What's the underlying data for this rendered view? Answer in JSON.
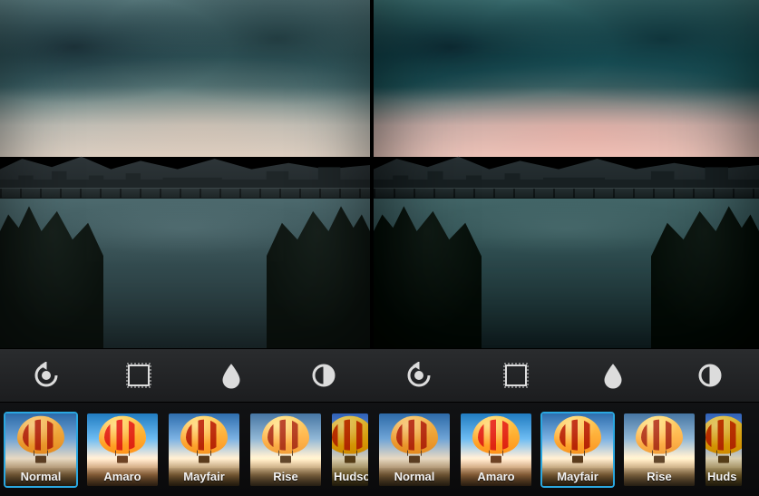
{
  "panes": {
    "left": {
      "applied_filter": "Normal"
    },
    "right": {
      "applied_filter": "Mayfair"
    }
  },
  "toolbar": {
    "items": [
      {
        "name": "rotate",
        "icon": "rotate-icon"
      },
      {
        "name": "border",
        "icon": "frame-icon"
      },
      {
        "name": "tiltshift",
        "icon": "droplet-icon"
      },
      {
        "name": "lux",
        "icon": "contrast-icon"
      }
    ]
  },
  "filters": {
    "left": [
      {
        "label": "Normal",
        "selected": true
      },
      {
        "label": "Amaro",
        "selected": false
      },
      {
        "label": "Mayfair",
        "selected": false
      },
      {
        "label": "Rise",
        "selected": false
      },
      {
        "label": "Hudson",
        "selected": false,
        "cut": true,
        "display": "Hudso"
      }
    ],
    "right": [
      {
        "label": "Normal",
        "selected": false
      },
      {
        "label": "Amaro",
        "selected": false
      },
      {
        "label": "Mayfair",
        "selected": true
      },
      {
        "label": "Rise",
        "selected": false
      },
      {
        "label": "Hudson",
        "selected": false,
        "cut": true,
        "display": "Huds"
      }
    ]
  }
}
